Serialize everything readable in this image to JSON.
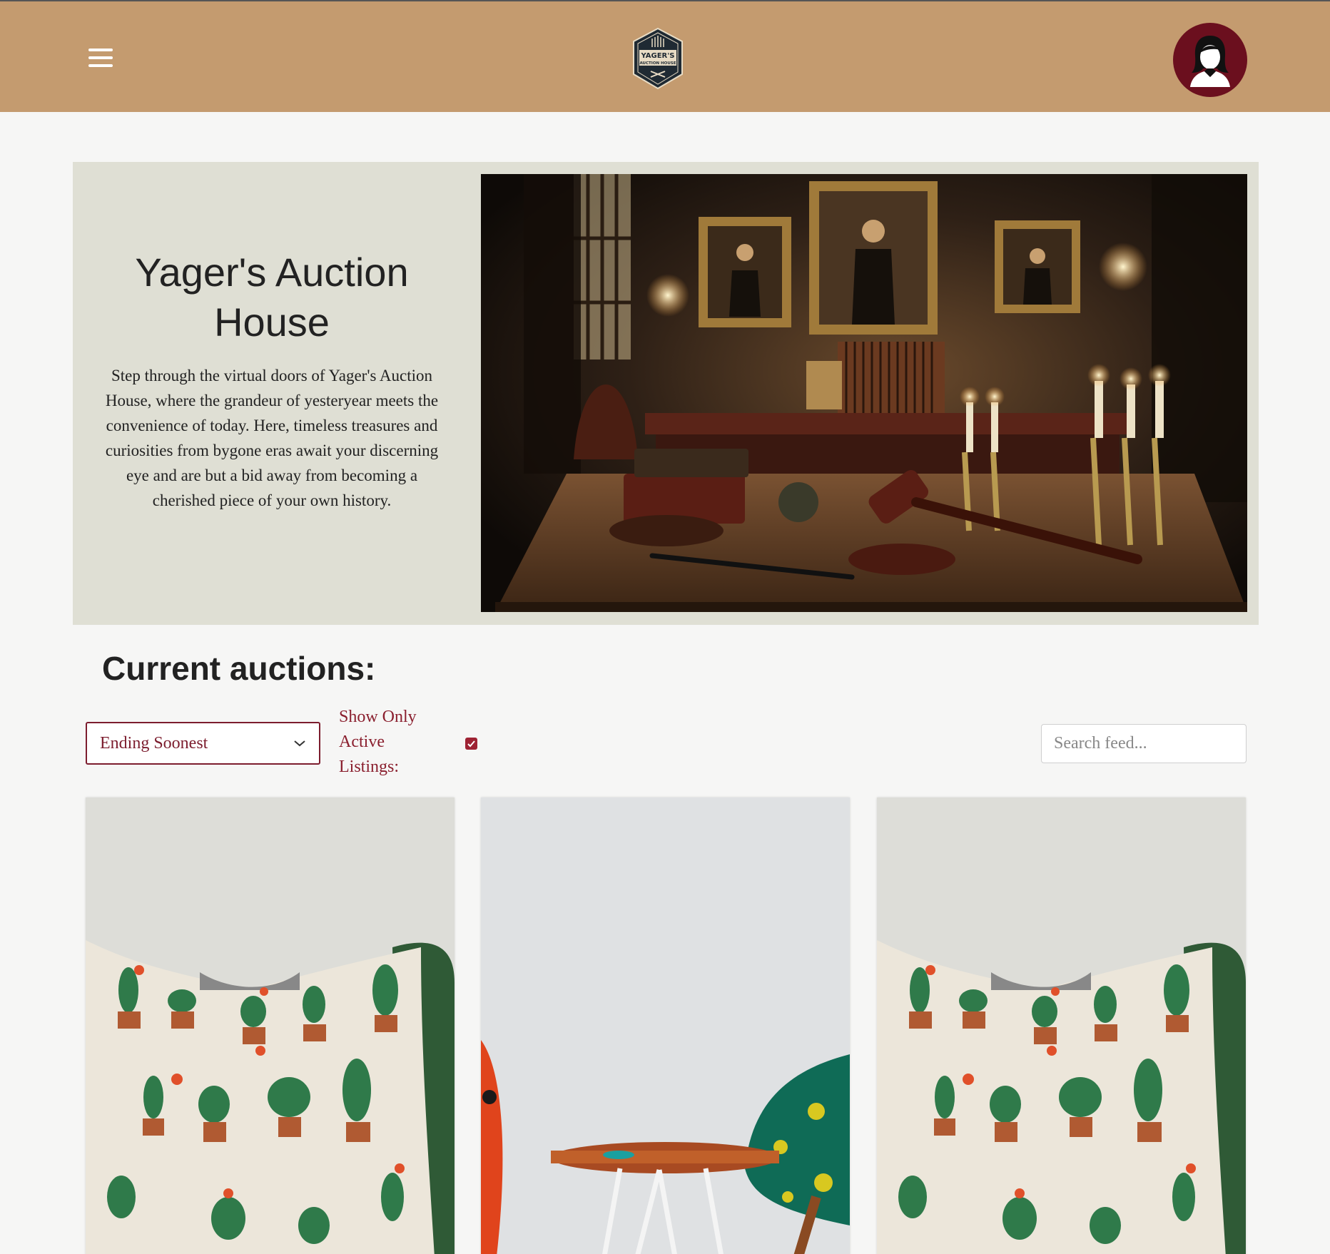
{
  "header": {
    "menu_icon": "hamburger-icon",
    "logo_text_line1": "YAGER'S",
    "logo_text_line2": "AUCTION HOUSE",
    "avatar_icon": "user-avatar-icon",
    "colors": {
      "bar": "#c49b6f",
      "avatar": "#6b0f1e"
    }
  },
  "hero": {
    "title": "Yager's Auction House",
    "description": "Step through the virtual doors of Yager's Auction House, where the grandeur of yesteryear meets the convenience of today. Here, timeless treasures and curiosities from bygone eras await your discerning eye and are but a bid away from becoming a cherished piece of your own history."
  },
  "auctions": {
    "heading": "Current auctions:",
    "sort": {
      "selected": "Ending Soonest",
      "icon": "chevron-down-icon"
    },
    "filter": {
      "label": "Show Only Active Listings:",
      "checked": true
    },
    "search": {
      "placeholder": "Search feed..."
    },
    "listings": [
      {
        "image": "cactus-pillow"
      },
      {
        "image": "wood-side-table"
      },
      {
        "image": "cactus-pillow"
      }
    ]
  }
}
